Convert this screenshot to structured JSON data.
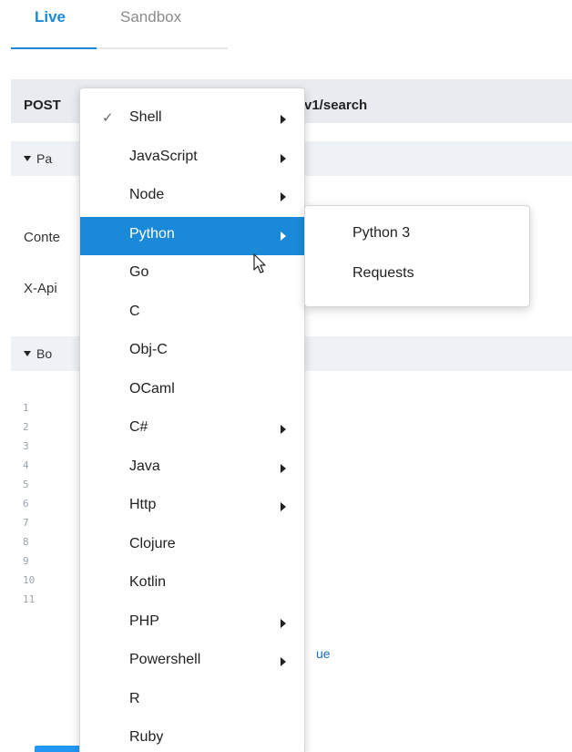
{
  "tabs": [
    {
      "label": "Live",
      "active": true
    },
    {
      "label": "Sandbox",
      "active": false
    }
  ],
  "request": {
    "method": "POST",
    "url_fragment": "v1/search"
  },
  "sections": {
    "params_fragment": "Pa",
    "body_fragment": "Bo"
  },
  "header_rows": {
    "content_type_fragment": "Conte",
    "api_key_fragment": "X-Api"
  },
  "code": {
    "line_numbers": [
      "1",
      "2",
      "3",
      "4",
      "5",
      "6",
      "7",
      "8",
      "9",
      "10",
      "11"
    ],
    "visible_fragment": "ue"
  },
  "language_menu": {
    "selected": "Shell",
    "highlighted": "Python",
    "items": [
      {
        "label": "Shell",
        "checked": true,
        "has_submenu": true
      },
      {
        "label": "JavaScript",
        "has_submenu": true
      },
      {
        "label": "Node",
        "has_submenu": true
      },
      {
        "label": "Python",
        "has_submenu": true
      },
      {
        "label": "Go",
        "has_submenu": false
      },
      {
        "label": "C",
        "has_submenu": false
      },
      {
        "label": "Obj-C",
        "has_submenu": false
      },
      {
        "label": "OCaml",
        "has_submenu": false
      },
      {
        "label": "C#",
        "has_submenu": true
      },
      {
        "label": "Java",
        "has_submenu": true
      },
      {
        "label": "Http",
        "has_submenu": true
      },
      {
        "label": "Clojure",
        "has_submenu": false
      },
      {
        "label": "Kotlin",
        "has_submenu": false
      },
      {
        "label": "PHP",
        "has_submenu": true
      },
      {
        "label": "Powershell",
        "has_submenu": true
      },
      {
        "label": "R",
        "has_submenu": false
      },
      {
        "label": "Ruby",
        "has_submenu": false
      }
    ],
    "check_glyph": "✓"
  },
  "python_submenu": {
    "items": [
      {
        "label": "Python 3"
      },
      {
        "label": "Requests"
      }
    ]
  },
  "colors": {
    "accent": "#1a8ad8",
    "highlight_text": "#ffffff",
    "header_bg": "#e8ecf1"
  }
}
